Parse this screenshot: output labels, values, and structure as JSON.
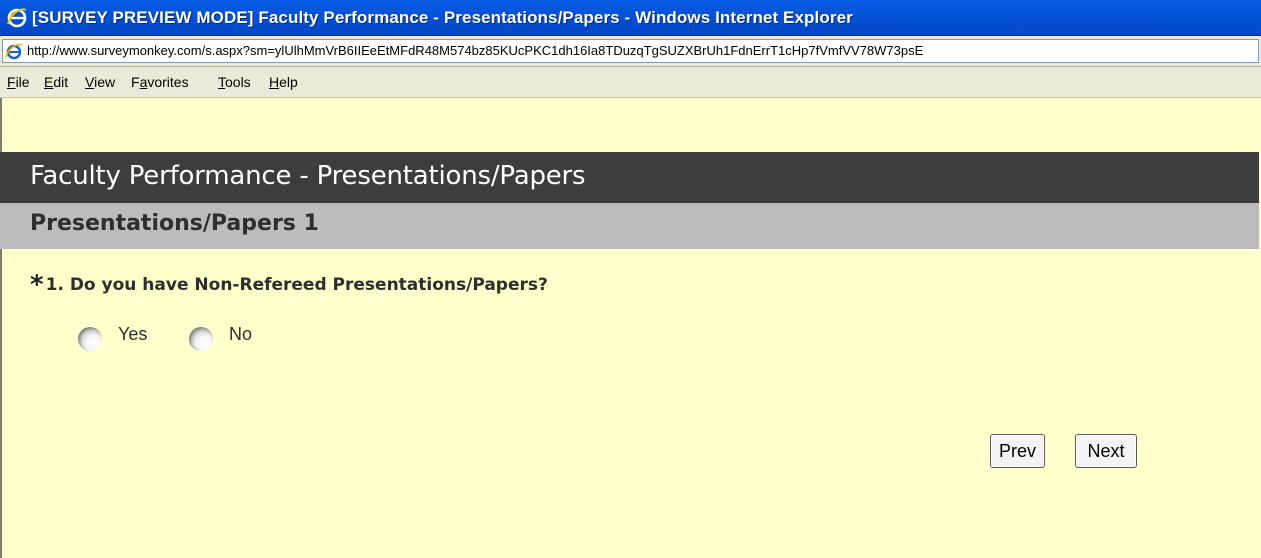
{
  "window": {
    "title": "[SURVEY PREVIEW MODE] Faculty Performance - Presentations/Papers - Windows Internet Explorer",
    "url": "http://www.surveymonkey.com/s.aspx?sm=ylUlhMmVrB6IIEeEtMFdR48M574bz85KUcPKC1dh16Ia8TDuzqTgSUZXBrUh1FdnErrT1cHp7fVmfVV78W73psE",
    "icon": "internet-explorer-icon"
  },
  "menu": {
    "items": [
      {
        "label": "File",
        "hotkey": "F",
        "rest": "ile"
      },
      {
        "label": "Edit",
        "hotkey": "E",
        "rest": "dit"
      },
      {
        "label": "View",
        "hotkey": "V",
        "rest": "iew"
      },
      {
        "label": "Favorites",
        "hotkey_prefix": "F",
        "hotkey": "a",
        "rest": "vorites"
      },
      {
        "label": "Tools",
        "hotkey": "T",
        "rest": "ools"
      },
      {
        "label": "Help",
        "hotkey": "H",
        "rest": "elp"
      }
    ]
  },
  "survey": {
    "title": "Faculty Performance - Presentations/Papers",
    "page_title": "Presentations/Papers 1",
    "question": {
      "required_mark": "*",
      "text": "1. Do you have Non-Refereed Presentations/Papers?",
      "options": [
        "Yes",
        "No"
      ]
    },
    "nav": {
      "prev": "Prev",
      "next": "Next"
    }
  },
  "colors": {
    "titlebar": "#0453d8",
    "content_background": "#ffffcc",
    "banner": "#3d3d3d",
    "section_bar": "#bcbcbc"
  }
}
